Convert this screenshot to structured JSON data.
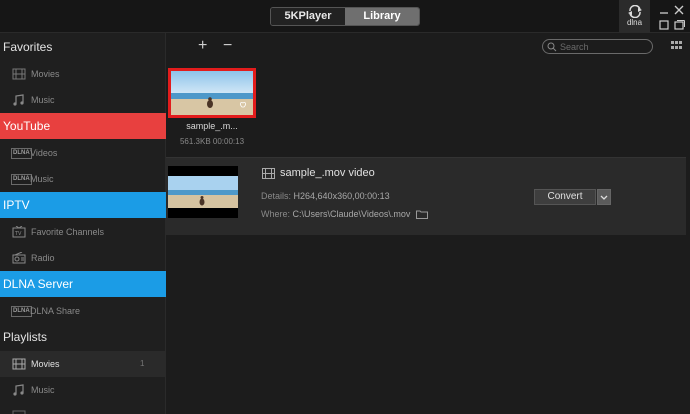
{
  "titlebar": {
    "tabs": [
      "5KPlayer",
      "Library"
    ],
    "active_tab": "Library",
    "dlna_label": "dlna"
  },
  "sidebar": {
    "sections": [
      {
        "label": "Favorites",
        "style": "plain"
      },
      {
        "label": "YouTube",
        "style": "red"
      },
      {
        "label": "IPTV",
        "style": "blue"
      },
      {
        "label": "DLNA Server",
        "style": "blue"
      },
      {
        "label": "Playlists",
        "style": "plain"
      }
    ],
    "favorites_items": [
      {
        "label": "Movies",
        "icon": "film-icon"
      },
      {
        "label": "Music",
        "icon": "music-note-icon"
      }
    ],
    "youtube_items": [
      {
        "label": "Videos",
        "icon": "dlna-tag-icon",
        "tag": "DLNA"
      },
      {
        "label": "Music",
        "icon": "dlna-tag-icon",
        "tag": "DLNA"
      }
    ],
    "iptv_items": [
      {
        "label": "Favorite Channels",
        "icon": "tv-icon"
      },
      {
        "label": "Radio",
        "icon": "radio-icon"
      }
    ],
    "dlna_items": [
      {
        "label": "DLNA Share",
        "icon": "dlna-tag-icon",
        "tag": "DLNA"
      }
    ],
    "playlist_items": [
      {
        "label": "Movies",
        "icon": "film-icon",
        "count": "1",
        "active": true
      },
      {
        "label": "Music",
        "icon": "music-note-icon"
      }
    ]
  },
  "toolbar": {
    "add": "+",
    "remove": "−",
    "search_placeholder": "Search"
  },
  "library": {
    "thumb_name": "sample_.m...",
    "thumb_meta": "561.3KB 00:00:13"
  },
  "detail": {
    "title": "sample_.mov video",
    "details_label": "Details:",
    "details_value": "H264,640x360,00:00:13",
    "where_label": "Where:",
    "where_value": "C:\\Users\\Claude\\Videos\\.mov",
    "convert_label": "Convert"
  },
  "colors": {
    "youtube": "#e8403f",
    "blue_section": "#1b9ce6",
    "selection_border": "#e21c1c"
  }
}
